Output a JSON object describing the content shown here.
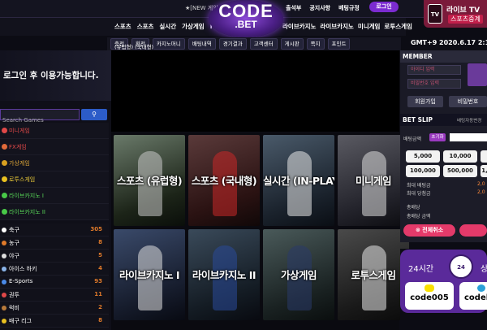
{
  "topbar": {
    "notice": "★[NEW 게임 추가] 유로컵 진행중",
    "links": [
      "출석부",
      "공지사항",
      "베팅규정"
    ],
    "login_label": "로그인"
  },
  "logo": {
    "line1": "CODE",
    "line2": ".BET"
  },
  "live_tv": {
    "icon": "TV",
    "title": "라이브 TV",
    "subtitle": "스포츠중계"
  },
  "nav_left": [
    "스포츠",
    "스포츠",
    "실시간",
    "가상게임",
    "FX게임"
  ],
  "nav_right": [
    "라이브카지노",
    "라이브카지노",
    "미니게임",
    "로투스게임"
  ],
  "sub_tabs": [
    "충전",
    "환전",
    "카지노머니",
    "배팅내역",
    "경기결과",
    "고객센터",
    "게시판",
    "쪽지",
    "포인트"
  ],
  "banner_label": "(유럽형) (국내형)",
  "gmt_time": "GMT+9 2020.6.17 2:15:3",
  "sidebar": {
    "login_message": "로그인 후 이용가능합니다.",
    "search_placeholder": "Search Games",
    "menu": [
      "미니게임",
      "FX게임",
      "가상게임",
      "로투스게임",
      "라이브카지노 I",
      "라이브카지노 II"
    ],
    "sports": [
      {
        "name": "축구",
        "count": "305"
      },
      {
        "name": "농구",
        "count": "8"
      },
      {
        "name": "야구",
        "count": "5"
      },
      {
        "name": "아이스 하키",
        "count": "4"
      },
      {
        "name": "E-Sports",
        "count": "93"
      },
      {
        "name": "권투",
        "count": "11"
      },
      {
        "name": "럭비",
        "count": "2"
      },
      {
        "name": "배구 리그",
        "count": "8"
      }
    ]
  },
  "games": [
    "스포츠 (유럽형)",
    "스포츠 (국내형)",
    "실시간 (IN-PLAY)",
    "미니게임",
    "라이브카지노 I",
    "라이브카지노 II",
    "가상게임",
    "로투스게임"
  ],
  "member": {
    "title": "MEMBER",
    "id_placeholder": "아이디 입력",
    "pw_placeholder": "비밀번호 입력",
    "join_label": "회원가입",
    "find_pw_label": "비밀번호"
  },
  "bet_slip": {
    "title": "BET SLIP",
    "subtitle": "배팅자동변경",
    "amount_label": "배팅금액",
    "reset_label": "초기화",
    "quick_amounts": [
      "5,000",
      "10,000",
      "50,000",
      "100,000",
      "500,000",
      "1,000,000"
    ],
    "min_label": "최대 배팅금",
    "min_value": "2,0",
    "max_label": "최대 당첨금",
    "max_value": "2,0",
    "total_odds_label": "총배당",
    "total_win_label": "총배당 금액",
    "clear_label": "전체취소"
  },
  "support": {
    "label_24": "24시간",
    "clock_text": "24",
    "right_text": "상",
    "kakao_id": "code005",
    "telegram_id": "codeb"
  },
  "colors": {
    "accent": "#7b2bd0",
    "pink": "#e43a6a",
    "count": "#e07a2a"
  }
}
